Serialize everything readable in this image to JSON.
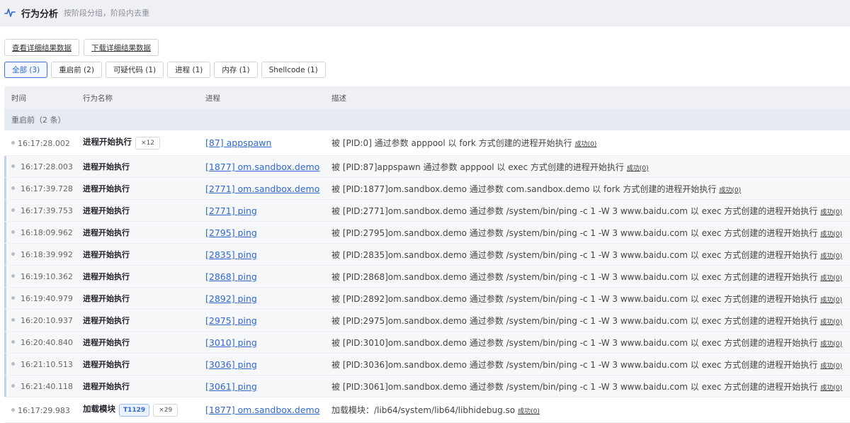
{
  "header": {
    "title": "行为分析",
    "subtitle": "按阶段分组，阶段内去重"
  },
  "buttons": {
    "view_details": "查看详细结果数据",
    "download_details": "下载详细结果数据"
  },
  "filters": [
    "全部 (3)",
    "重启前 (2)",
    "可疑代码 (1)",
    "进程 (1)",
    "内存 (1)",
    "Shellcode (1)"
  ],
  "columns": {
    "time": "时间",
    "action": "行为名称",
    "process": "进程",
    "desc": "描述"
  },
  "group_label": "重启前（2 条）",
  "rows": [
    {
      "time": "16:17:28.002",
      "action": "进程开始执行",
      "count": "×12",
      "process": "[87] appspawn",
      "desc": "被 [PID:0] 通过参数 apppool 以 fork 方式创建的进程开始执行",
      "status": "成功(0)"
    },
    {
      "time": "16:17:28.003",
      "action": "进程开始执行",
      "process": "[1877] om.sandbox.demo",
      "desc": "被 [PID:87]appspawn 通过参数 apppool 以 exec 方式创建的进程开始执行",
      "status": "成功(0)"
    },
    {
      "time": "16:17:39.728",
      "action": "进程开始执行",
      "process": "[2771] om.sandbox.demo",
      "desc": "被 [PID:1877]om.sandbox.demo 通过参数 com.sandbox.demo 以 fork 方式创建的进程开始执行",
      "status": "成功(0)"
    },
    {
      "time": "16:17:39.753",
      "action": "进程开始执行",
      "process": "[2771] ping",
      "desc": "被 [PID:2771]om.sandbox.demo 通过参数 /system/bin/ping -c 1 -W 3 www.baidu.com 以 exec 方式创建的进程开始执行",
      "status": "成功(0)"
    },
    {
      "time": "16:18:09.962",
      "action": "进程开始执行",
      "process": "[2795] ping",
      "desc": "被 [PID:2795]om.sandbox.demo 通过参数 /system/bin/ping -c 1 -W 3 www.baidu.com 以 exec 方式创建的进程开始执行",
      "status": "成功(0)"
    },
    {
      "time": "16:18:39.992",
      "action": "进程开始执行",
      "process": "[2835] ping",
      "desc": "被 [PID:2835]om.sandbox.demo 通过参数 /system/bin/ping -c 1 -W 3 www.baidu.com 以 exec 方式创建的进程开始执行",
      "status": "成功(0)"
    },
    {
      "time": "16:19:10.362",
      "action": "进程开始执行",
      "process": "[2868] ping",
      "desc": "被 [PID:2868]om.sandbox.demo 通过参数 /system/bin/ping -c 1 -W 3 www.baidu.com 以 exec 方式创建的进程开始执行",
      "status": "成功(0)"
    },
    {
      "time": "16:19:40.979",
      "action": "进程开始执行",
      "process": "[2892] ping",
      "desc": "被 [PID:2892]om.sandbox.demo 通过参数 /system/bin/ping -c 1 -W 3 www.baidu.com 以 exec 方式创建的进程开始执行",
      "status": "成功(0)"
    },
    {
      "time": "16:20:10.937",
      "action": "进程开始执行",
      "process": "[2975] ping",
      "desc": "被 [PID:2975]om.sandbox.demo 通过参数 /system/bin/ping -c 1 -W 3 www.baidu.com 以 exec 方式创建的进程开始执行",
      "status": "成功(0)"
    },
    {
      "time": "16:20:40.840",
      "action": "进程开始执行",
      "process": "[3010] ping",
      "desc": "被 [PID:3010]om.sandbox.demo 通过参数 /system/bin/ping -c 1 -W 3 www.baidu.com 以 exec 方式创建的进程开始执行",
      "status": "成功(0)"
    },
    {
      "time": "16:21:10.513",
      "action": "进程开始执行",
      "process": "[3036] ping",
      "desc": "被 [PID:3036]om.sandbox.demo 通过参数 /system/bin/ping -c 1 -W 3 www.baidu.com 以 exec 方式创建的进程开始执行",
      "status": "成功(0)"
    },
    {
      "time": "16:21:40.118",
      "action": "进程开始执行",
      "process": "[3061] ping",
      "desc": "被 [PID:3061]om.sandbox.demo 通过参数 /system/bin/ping -c 1 -W 3 www.baidu.com 以 exec 方式创建的进程开始执行",
      "status": "成功(0)"
    },
    {
      "time": "16:17:29.983",
      "action": "加载模块",
      "tag": "T1129",
      "count": "×29",
      "process": "[1877] om.sandbox.demo",
      "desc": "加载模块：/lib64/system/lib64/libhidebug.so",
      "status": "成功(0)"
    }
  ],
  "colors": {
    "accent": "#2f67d0",
    "header_bg": "#eef0f4",
    "group_bg": "#e6eaf2"
  }
}
